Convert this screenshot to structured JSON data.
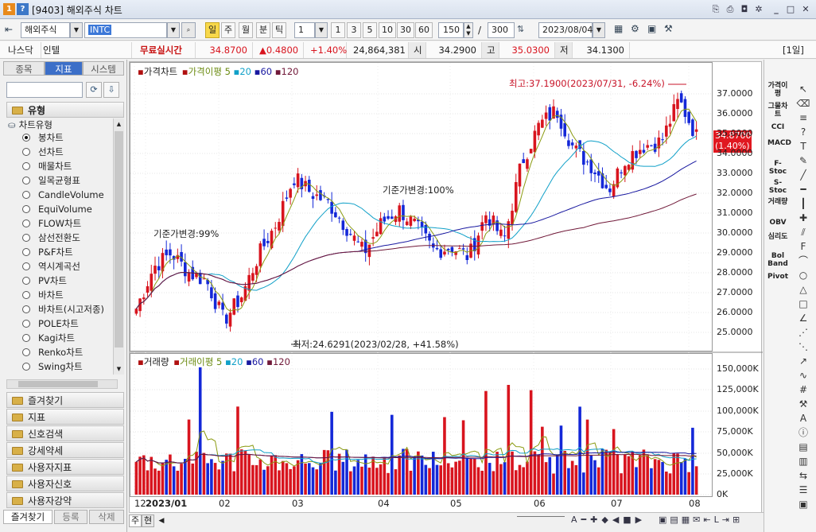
{
  "titlebar": {
    "badge1": "1",
    "badge2": "?",
    "title": "[9403] 해외주식 차트"
  },
  "toolbar": {
    "market": "해외주식",
    "symbol": "INTC",
    "periods": [
      "일",
      "주",
      "월",
      "분",
      "틱"
    ],
    "interval_value": "1",
    "minute_buttons": [
      "1",
      "3",
      "5",
      "10",
      "30",
      "60"
    ],
    "count_value": "150",
    "separator": "/",
    "max_value": "300",
    "date_value": "2023/08/04"
  },
  "info": {
    "exchange": "나스닥",
    "name": "인텔",
    "realtime": "무료실시간",
    "price": "34.8700",
    "change": "▲0.4800",
    "change_pct": "+1.40%",
    "volume": "24,864,381",
    "open_label": "시",
    "open": "34.2900",
    "high_label": "고",
    "high": "35.0300",
    "low_label": "저",
    "low": "34.1300",
    "period_badge": "[1일]"
  },
  "left": {
    "tabs": [
      "종목",
      "지표",
      "시스템"
    ],
    "search_placeholder": "",
    "type_header": "유형",
    "tree_root": "차트유형",
    "chart_types": [
      "봉차트",
      "선차트",
      "매물차트",
      "일목균형표",
      "CandleVolume",
      "EquiVolume",
      "FLOW차트",
      "삼선전환도",
      "P&F차트",
      "역시계곡선",
      "PV차트",
      "바차트",
      "바차트(시고저종)",
      "POLE차트",
      "Kagi차트",
      "Renko차트",
      "Swing차트"
    ],
    "sections": [
      "즐겨찾기",
      "지표",
      "신호검색",
      "강세약세",
      "사용자지표",
      "사용자신호",
      "사용자강약"
    ],
    "bottom_tabs": [
      "즐겨찾기",
      "등록",
      "삭제"
    ]
  },
  "price_chart": {
    "legend_title": "가격차트",
    "legend_ma": "가격이평",
    "ma_periods": [
      "5",
      "20",
      "60",
      "120"
    ],
    "annotation_high": "최고:37.1900(2023/07/31, -6.24%)",
    "annotation_low": "최저:24.6291(2023/02/28, +41.58%)",
    "annotation_base1": "기준가변경:99%",
    "annotation_base2": "기준가변경:100%",
    "current_price": "34.8700",
    "current_pct": "(1.40%)",
    "y_ticks": [
      "37.0000",
      "36.0000",
      "35.0000",
      "34.0000",
      "33.0000",
      "32.0000",
      "31.0000",
      "30.0000",
      "29.0000",
      "28.0000",
      "27.0000",
      "26.0000",
      "25.0000"
    ]
  },
  "volume_chart": {
    "legend_title": "거래량",
    "legend_ma": "거래이평",
    "ma_periods": [
      "5",
      "20",
      "60",
      "120"
    ],
    "y_ticks": [
      "150,000K",
      "125,000K",
      "100,000K",
      "75,000K",
      "50,000K",
      "25,000K",
      "0K"
    ]
  },
  "x_axis": {
    "labels": [
      "12",
      "2023/01",
      "02",
      "03",
      "04",
      "05",
      "06",
      "07",
      "08"
    ]
  },
  "right_tools": {
    "indicators": [
      "가격이평",
      "그물차트",
      "CCI",
      "MACD",
      "F-Stoc",
      "S-Stoc",
      "거래량",
      "OBV",
      "심리도",
      "Bol Band",
      "Pivot"
    ]
  },
  "bottom": {
    "tab1": "주",
    "tab2": "현"
  },
  "colors": {
    "up": "#d8141e",
    "down": "#1428d8",
    "ma5": "#8a9a10",
    "ma20": "#10a0c8",
    "ma60": "#1818a0",
    "ma120": "#701838"
  },
  "chart_data": {
    "type": "candlestick",
    "title": "가격차트",
    "ylim": [
      24.5,
      37.5
    ],
    "x": [
      "2022/12",
      "2023/01",
      "2023/02",
      "2023/03",
      "2023/04",
      "2023/05",
      "2023/06",
      "2023/07",
      "2023/08"
    ],
    "close": [
      26.2,
      28.3,
      29.0,
      28.0,
      27.6,
      25.6,
      26.8,
      28.9,
      30.5,
      32.8,
      32.0,
      31.5,
      30.3,
      29.0,
      30.5,
      31.2,
      30.3,
      29.1,
      29.3,
      28.8,
      31.0,
      29.6,
      33.5,
      35.4,
      36.2,
      34.2,
      33.4,
      32.2,
      33.8,
      34.4,
      34.6,
      36.7,
      34.87
    ],
    "highlights": {
      "high": 37.19,
      "high_date": "2023/07/31",
      "low": 24.6291,
      "low_date": "2023/02/28"
    },
    "volume_ylim": [
      0,
      160000
    ],
    "volume_unit": "K"
  }
}
